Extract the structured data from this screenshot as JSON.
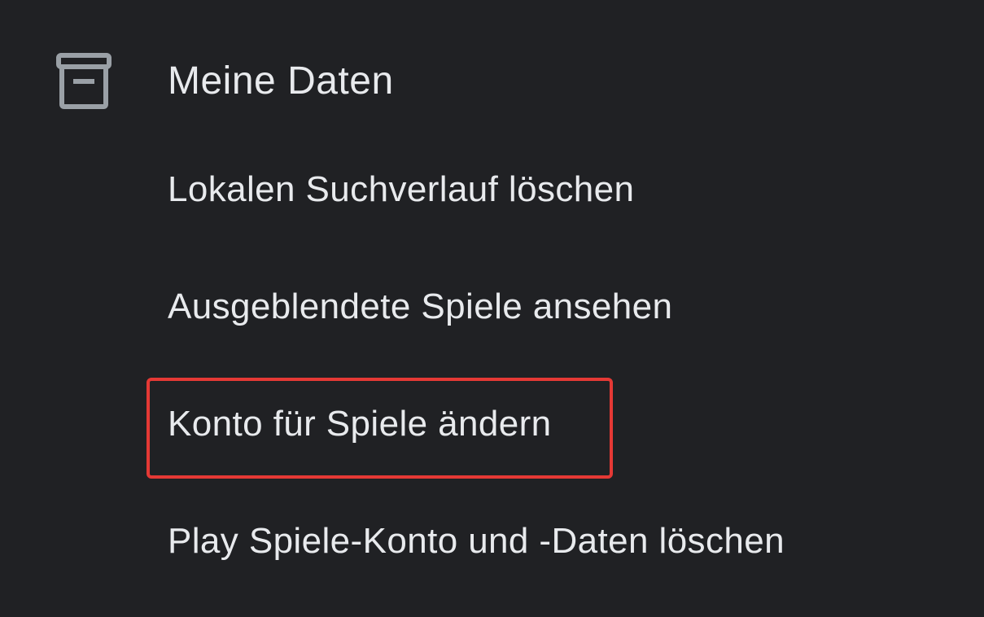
{
  "section": {
    "icon": "archive-icon",
    "title": "Meine Daten"
  },
  "menu": {
    "items": [
      {
        "label": "Lokalen Suchverlauf löschen"
      },
      {
        "label": "Ausgeblendete Spiele ansehen"
      },
      {
        "label": "Konto für Spiele ändern",
        "highlighted": true
      },
      {
        "label": "Play Spiele-Konto und -Daten löschen"
      }
    ]
  },
  "colors": {
    "background": "#202124",
    "text": "#e8eaed",
    "icon": "#9aa0a6",
    "highlight_border": "#e53935"
  }
}
